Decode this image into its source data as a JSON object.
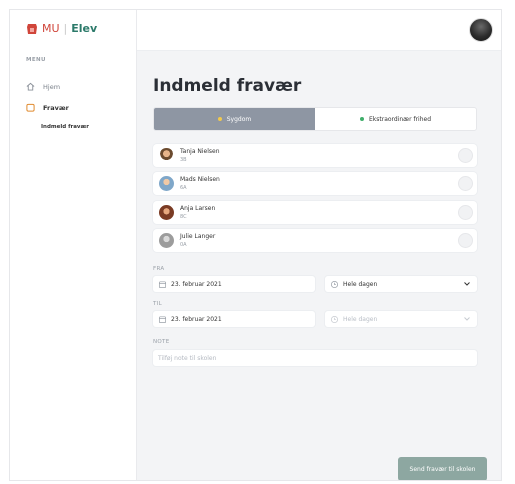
{
  "brand": {
    "mu": "MU",
    "separator": "|",
    "elev": "Elev"
  },
  "sidebar": {
    "menu_label": "MENU",
    "items": [
      {
        "label": "Hjem",
        "icon": "home-icon"
      },
      {
        "label": "Fravær",
        "icon": "calendar-icon"
      }
    ],
    "subitem": "Indmeld fravær"
  },
  "header": {
    "avatar": "user-avatar"
  },
  "page": {
    "title": "Indmeld fravær"
  },
  "absence_type": {
    "options": [
      {
        "label": "Sygdom",
        "selected": true,
        "dot_color": "#f2c94c"
      },
      {
        "label": "Ekstraordinær frihed",
        "selected": false,
        "dot_color": "#3fae6a"
      }
    ]
  },
  "students": [
    {
      "name": "Tanja Nielsen",
      "class": "3B"
    },
    {
      "name": "Mads Nielsen",
      "class": "6A"
    },
    {
      "name": "Anja Larsen",
      "class": "8C"
    },
    {
      "name": "Julie Langer",
      "class": "0A"
    }
  ],
  "from": {
    "label": "FRA",
    "date": "23. februar 2021",
    "time": "Hele dagen"
  },
  "to": {
    "label": "TIL",
    "date": "23. februar 2021",
    "time": "Hele dagen"
  },
  "note": {
    "label": "NOTE",
    "placeholder": "Tilføj note til skolen"
  },
  "submit": {
    "label": "Send fravær til skolen"
  },
  "colors": {
    "accent": "#2c7a6a",
    "segment_active": "#8e96a3",
    "submit_button": "#8da7a1"
  }
}
